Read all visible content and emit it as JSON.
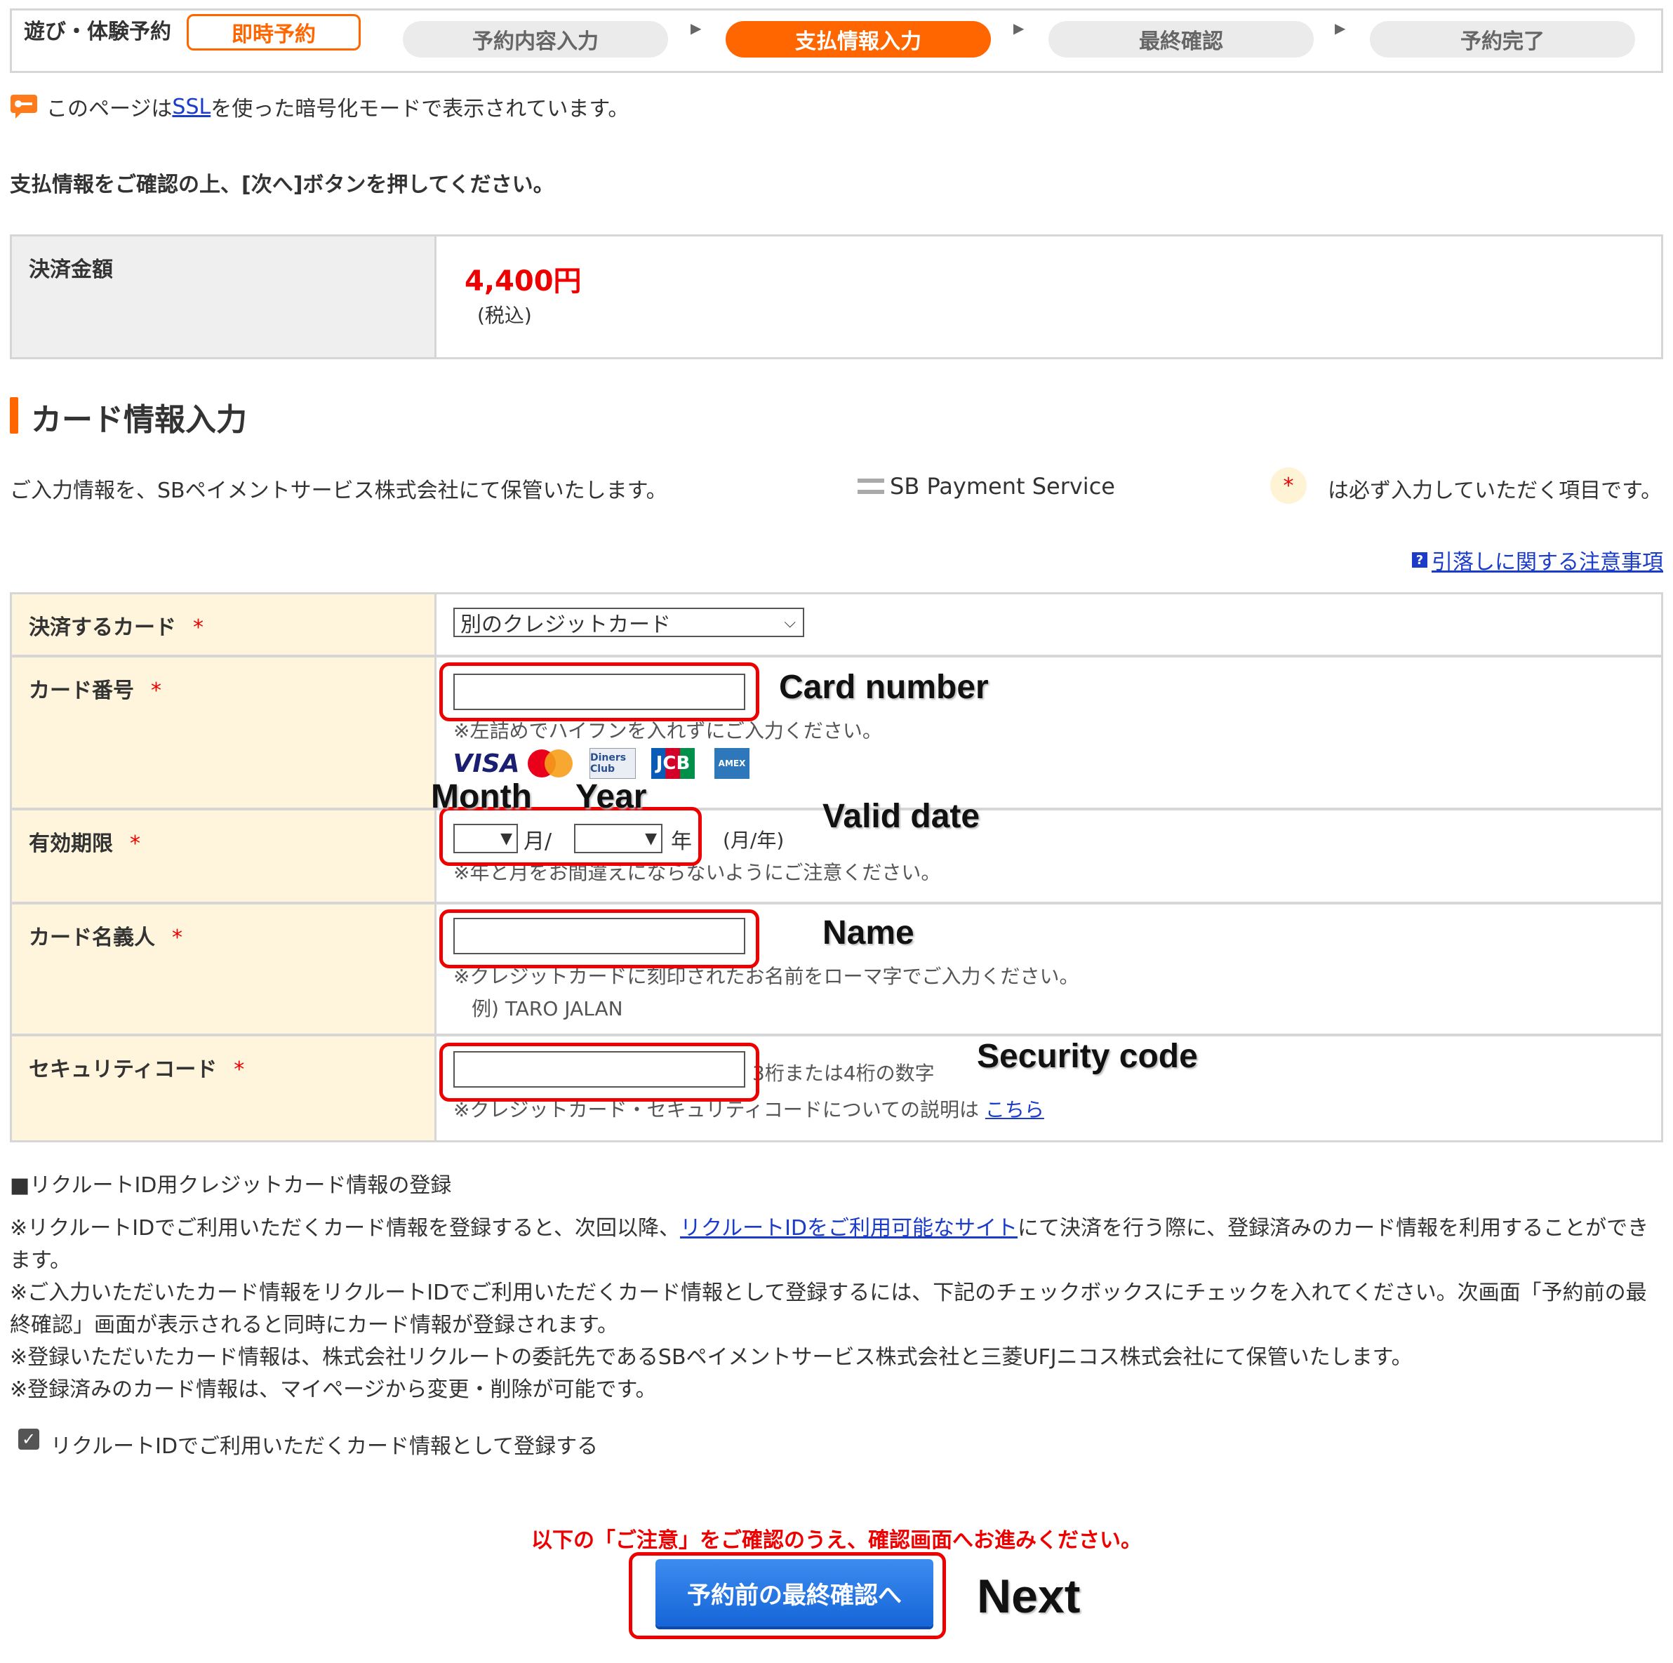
{
  "steps": {
    "category": "遊び・体験予約",
    "badge": "即時予約",
    "items": [
      "予約内容入力",
      "支払情報入力",
      "最終確認",
      "予約完了"
    ],
    "active": "支払情報入力"
  },
  "ssl": {
    "before": "このページは",
    "link": "SSL",
    "after": "を使った暗号化モードで表示されています。"
  },
  "instruction": "支払情報をご確認の上、[次へ]ボタンを押してください。",
  "amount": {
    "label": "決済金額",
    "value": "4,400円",
    "tax": "(税込)"
  },
  "card_section": {
    "title": "カード情報入力",
    "storage_note": "ご入力情報を、SBペイメントサービス株式会社にて保管いたします。",
    "provider_logo": "SB Payment Service",
    "required_mark": "*",
    "required_note": "は必ず入力していただく項目です。",
    "caution_link": "引落しに関する注意事項"
  },
  "form": {
    "card_select": {
      "label": "決済するカード",
      "value": "別のクレジットカード"
    },
    "card_number": {
      "label": "カード番号",
      "hint": "※左詰めでハイフンを入れずにご入力ください。",
      "value": ""
    },
    "brands": [
      "VISA",
      "MasterCard",
      "Diners Club",
      "JCB",
      "AMEX"
    ],
    "expiry": {
      "label": "有効期限",
      "month_unit": "月/",
      "year_unit": "年",
      "format": "(月/年)",
      "hint": "※年と月をお間違えにならないようにご注意ください。"
    },
    "holder": {
      "label": "カード名義人",
      "hint": "※クレジットカードに刻印されたお名前をローマ字でご入力ください。",
      "example": "例)  TARO JALAN",
      "value": ""
    },
    "security": {
      "label": "セキュリティコード",
      "digits": "3桁または4桁の数字",
      "hint": "※クレジットカード・セキュリティコードについての説明は",
      "link": "こちら",
      "value": ""
    }
  },
  "annotations": {
    "card_number": "Card number",
    "month": "Month",
    "year": "Year",
    "valid_date": "Valid date",
    "name": "Name",
    "security_code": "Security code",
    "next": "Next"
  },
  "registration": {
    "title": "■リクルートID用クレジットカード情報の登録",
    "line1_before": "※リクルートIDでご利用いただくカード情報を登録すると、次回以降、",
    "line1_link": "リクルートIDをご利用可能なサイト",
    "line1_after": "にて決済を行う際に、登録済みのカード情報を利用することができます。",
    "line2": "※ご入力いただいたカード情報をリクルートIDでご利用いただくカード情報として登録するには、下記のチェックボックスにチェックを入れてください。次画面「予約前の最終確認」画面が表示されると同時にカード情報が登録されます。",
    "line3": "※登録いただいたカード情報は、株式会社リクルートの委託先であるSBペイメントサービス株式会社と三菱UFJニコス株式会社にて保管いたします。",
    "line4": "※登録済みのカード情報は、マイページから変更・削除が可能です。",
    "checkbox_label": "リクルートIDでご利用いただくカード情報として登録する",
    "checkbox_checked": true
  },
  "footer": {
    "note": "以下の「ご注意」をご確認のうえ、確認画面へお進みください。",
    "next_button": "予約前の最終確認へ"
  },
  "colors": {
    "accent": "#ff6600",
    "required": "#ee0000",
    "link": "#1a3cc8",
    "button": "#1e6fe0",
    "label_bg": "#fff5dc"
  }
}
